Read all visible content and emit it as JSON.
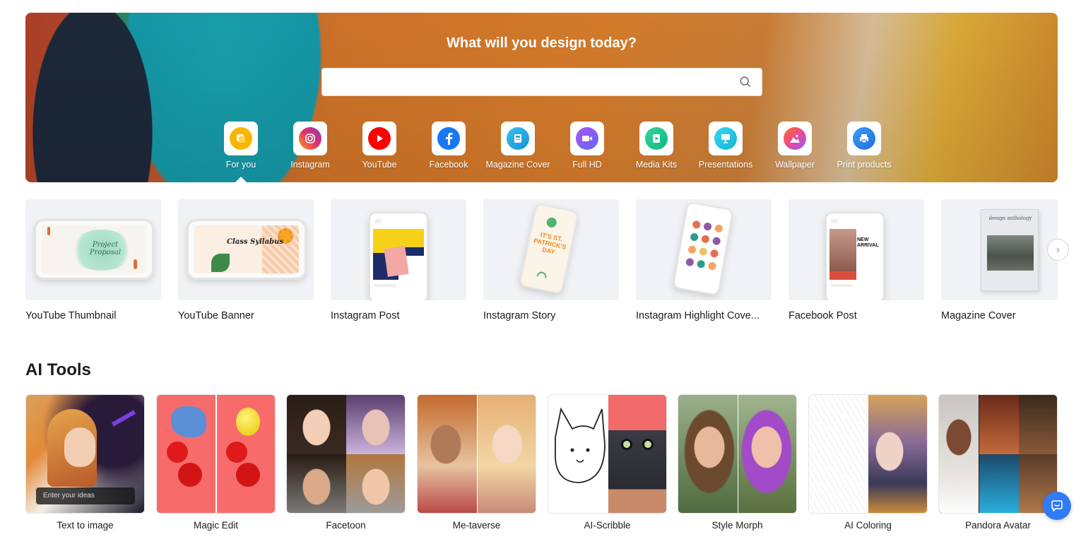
{
  "hero": {
    "title": "What will you design today?",
    "search": {
      "value": "",
      "placeholder": ""
    },
    "categories": [
      {
        "label": "For you",
        "icon": "for-you-icon",
        "color": "#f5b400",
        "active": true
      },
      {
        "label": "Instagram",
        "icon": "instagram-icon",
        "color": "#e1306c"
      },
      {
        "label": "YouTube",
        "icon": "youtube-icon",
        "color": "#ff0000"
      },
      {
        "label": "Facebook",
        "icon": "facebook-icon",
        "color": "#1877f2"
      },
      {
        "label": "Magazine Cover",
        "icon": "magazine-icon",
        "color": "#2aa8e0"
      },
      {
        "label": "Full HD",
        "icon": "video-icon",
        "color": "#8b5cf6"
      },
      {
        "label": "Media Kits",
        "icon": "media-kit-icon",
        "color": "#22c59a"
      },
      {
        "label": "Presentations",
        "icon": "presentation-icon",
        "color": "#22c3e6"
      },
      {
        "label": "Wallpaper",
        "icon": "wallpaper-icon",
        "color": "#f97316"
      },
      {
        "label": "Print products",
        "icon": "printer-icon",
        "color": "#2f8cf0"
      }
    ]
  },
  "templates": [
    {
      "title": "YouTube Thumbnail",
      "thumb_text": "Project Proposal"
    },
    {
      "title": "YouTube Banner",
      "thumb_text": "Class Syllabus"
    },
    {
      "title": "Instagram Post",
      "thumb_text": ""
    },
    {
      "title": "Instagram Story",
      "thumb_text": "IT'S ST. PATRICK'S DAY"
    },
    {
      "title": "Instagram Highlight Cove...",
      "thumb_text": ""
    },
    {
      "title": "Facebook Post",
      "thumb_text": "NEW ARRIVAL"
    },
    {
      "title": "Magazine Cover",
      "thumb_text": "design anthology"
    }
  ],
  "ai_tools": {
    "title": "AI Tools",
    "prompt_placeholder": "Enter your ideas",
    "items": [
      {
        "label": "Text to image"
      },
      {
        "label": "Magic Edit"
      },
      {
        "label": "Facetoon"
      },
      {
        "label": "Me-taverse"
      },
      {
        "label": "AI-Scribble"
      },
      {
        "label": "Style Morph"
      },
      {
        "label": "AI Coloring"
      },
      {
        "label": "Pandora Avatar"
      }
    ]
  },
  "colors": {
    "accent": "#2f7cf6",
    "card_bg": "#f1f2f5"
  },
  "chat": {
    "icon": "chat-icon"
  }
}
